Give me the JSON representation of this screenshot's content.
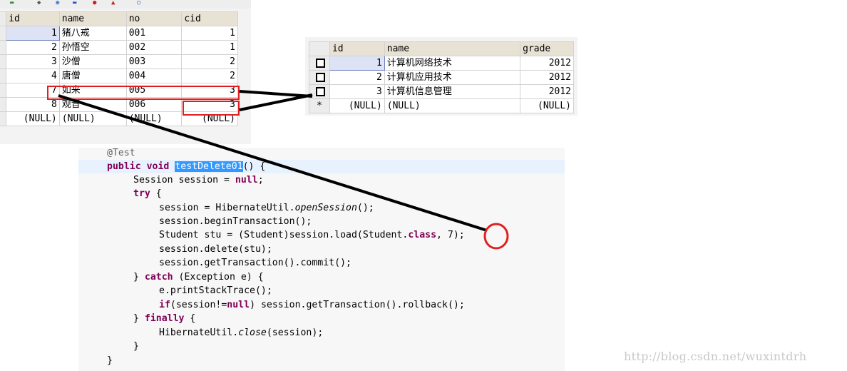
{
  "student_table": {
    "columns": [
      "id",
      "name",
      "no",
      "cid"
    ],
    "rows": [
      [
        "1",
        "猪八戒",
        "001",
        "1"
      ],
      [
        "2",
        "孙悟空",
        "002",
        "1"
      ],
      [
        "3",
        "沙僧",
        "003",
        "2"
      ],
      [
        "4",
        "唐僧",
        "004",
        "2"
      ],
      [
        "7",
        "如来",
        "005",
        "3"
      ],
      [
        "8",
        "观音",
        "006",
        "3"
      ],
      [
        "(NULL)",
        "(NULL)",
        "(NULL)",
        "(NULL)"
      ]
    ]
  },
  "class_table": {
    "columns": [
      "id",
      "name",
      "grade"
    ],
    "rows": [
      [
        "1",
        "计算机网络技术",
        "2012"
      ],
      [
        "2",
        "计算机应用技术",
        "2012"
      ],
      [
        "3",
        "计算机信息管理",
        "2012"
      ],
      [
        "(NULL)",
        "(NULL)",
        "(NULL)"
      ]
    ],
    "new_row_marker": "*"
  },
  "code": {
    "annotation": "@Test",
    "l2_kw1": "public",
    "l2_kw2": "void",
    "l2_method": "testDelete01",
    "l2_rest": "() {",
    "l3a": "Session session = ",
    "l3_kw": "null",
    "l3b": ";",
    "l4_kw": "try",
    "l4b": " {",
    "l5a": "session = HibernateUtil.",
    "l5_it": "openSession",
    "l5b": "();",
    "l6": "session.beginTransaction();",
    "l7a": "Student stu = (Student)session.load(Student.",
    "l7_kw": "class",
    "l7b": ", 7);",
    "l8": "session.delete(stu);",
    "l9": "session.getTransaction().commit();",
    "l10a": "} ",
    "l10_kw": "catch",
    "l10b": " (Exception e) {",
    "l11": "e.printStackTrace();",
    "l12_kw1": "if",
    "l12a": "(session!=",
    "l12_kw2": "null",
    "l12b": ") session.getTransaction().rollback();",
    "l13a": "} ",
    "l13_kw": "finally",
    "l13b": " {",
    "l14a": "HibernateUtil.",
    "l14_it": "close",
    "l14b": "(session);",
    "l15": "}",
    "l16": "}"
  },
  "watermark": "http://blog.csdn.net/wuxintdrh",
  "colors": {
    "highlight": "#e02020",
    "keyword": "#7f0055",
    "selection": "#3399ff"
  }
}
